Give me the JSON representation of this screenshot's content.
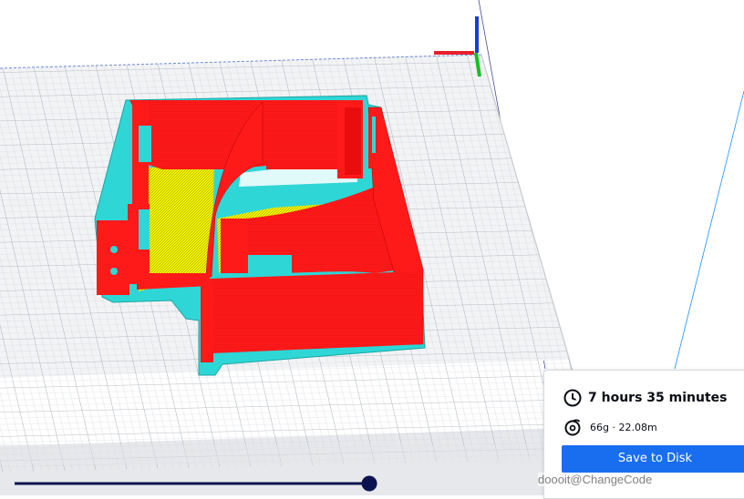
{
  "print_summary": {
    "time_icon": "clock-icon",
    "estimated_time": "7 hours 35 minutes",
    "material_icon": "filament-spool-icon",
    "material_usage": "66g · 22.08m",
    "save_label": "Save to Disk"
  },
  "layer_slider": {
    "position": 0.98
  },
  "watermark": "doooit@ChangeCode",
  "colors": {
    "wall": "#ff1a1a",
    "infill": "#f5f500",
    "skirt": "#2fd6d6",
    "axis_x": "#e4202a",
    "axis_y": "#15c021",
    "axis_z": "#1c3ccf",
    "accent": "#196ef0"
  }
}
